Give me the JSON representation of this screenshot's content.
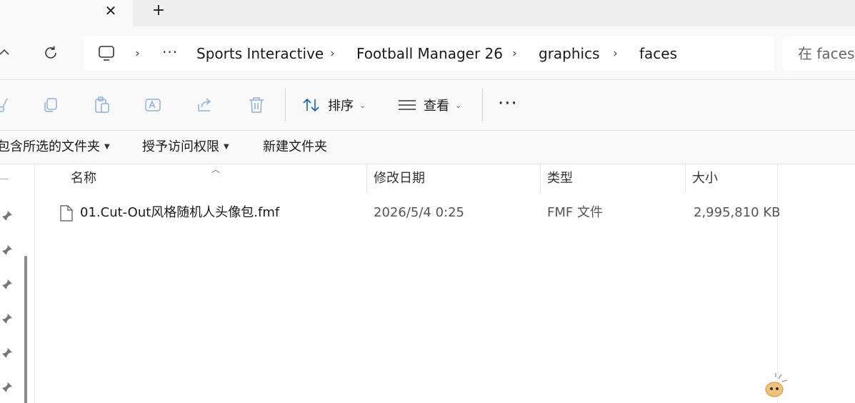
{
  "tabs": {
    "close_symbol": "✕",
    "new_tab_symbol": "+"
  },
  "address": {
    "overflow_symbol": "···",
    "breadcrumb": [
      "Sports Interactive",
      "Football Manager 26",
      "graphics",
      "faces"
    ],
    "separator": "›",
    "search_placeholder": "在 faces 中搜索"
  },
  "toolbar": {
    "sort_label": "排序",
    "view_label": "查看",
    "more_symbol": "···"
  },
  "commands": {
    "include_label": "包含所选的文件夹",
    "grant_label": "授予访问权限",
    "new_folder_label": "新建文件夹"
  },
  "columns": {
    "name": "名称",
    "modified": "修改日期",
    "type": "类型",
    "size": "大小"
  },
  "files": [
    {
      "name": "01.Cut-Out风格随机人头像包.fmf",
      "modified": "2026/5/4 0:25",
      "type": "FMF 文件",
      "size": "2,995,810 KB"
    }
  ],
  "colors": {
    "background": "#ffffff",
    "chrome": "#f9f9f9",
    "titlebar": "#eeeeee",
    "accent": "#1a5fb4"
  }
}
